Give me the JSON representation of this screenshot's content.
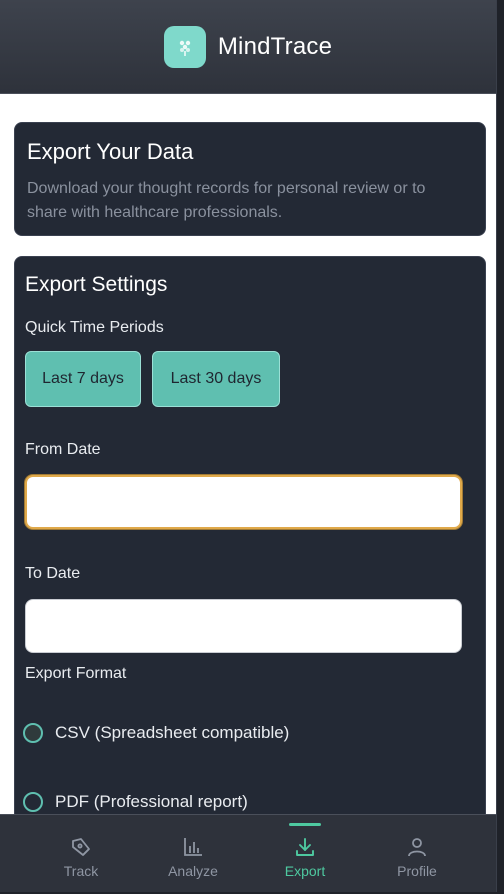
{
  "app": {
    "title": "MindTrace",
    "accent": "#5fbfb0",
    "tab_active_color": "#4ec9a0"
  },
  "intro": {
    "title": "Export Your Data",
    "description": "Download your thought records for personal review or to share with healthcare professionals."
  },
  "settings": {
    "title": "Export Settings",
    "quick_periods_label": "Quick Time Periods",
    "quick_periods": [
      "Last 7 days",
      "Last 30 days"
    ],
    "from_label": "From Date",
    "from_value": "",
    "to_label": "To Date",
    "to_value": "",
    "format_label": "Export Format",
    "formats": [
      "CSV (Spreadsheet compatible)",
      "PDF (Professional report)"
    ]
  },
  "tabs": [
    {
      "label": "Track",
      "icon": "pen-icon"
    },
    {
      "label": "Analyze",
      "icon": "bar-chart-icon"
    },
    {
      "label": "Export",
      "icon": "download-icon",
      "active": true
    },
    {
      "label": "Profile",
      "icon": "user-icon"
    }
  ]
}
